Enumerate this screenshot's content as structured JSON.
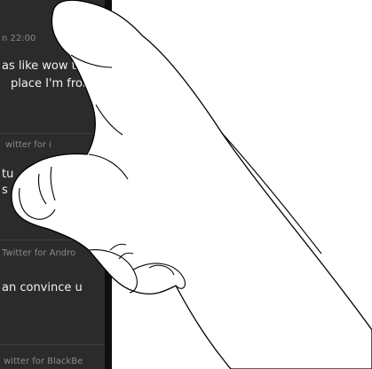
{
  "tweets": [
    {
      "meta": "n 22:00",
      "text_line1": "as like wow they",
      "text_line2": "place I'm from"
    },
    {
      "meta": "witter for i",
      "text_line1": "tu",
      "text_line2": "s"
    },
    {
      "meta": "Twitter for Andro",
      "text_line1": "an convince u",
      "text_line2": ""
    },
    {
      "meta": "witter for BlackBe",
      "text_line1": "",
      "text_line2": ""
    }
  ],
  "colors": {
    "screen_background": "#2b2b2b",
    "tweet_text": "#f2f2f2",
    "meta_text": "#8a8a8a",
    "hand_fill": "#ffffff",
    "hand_outline": "#000000"
  }
}
